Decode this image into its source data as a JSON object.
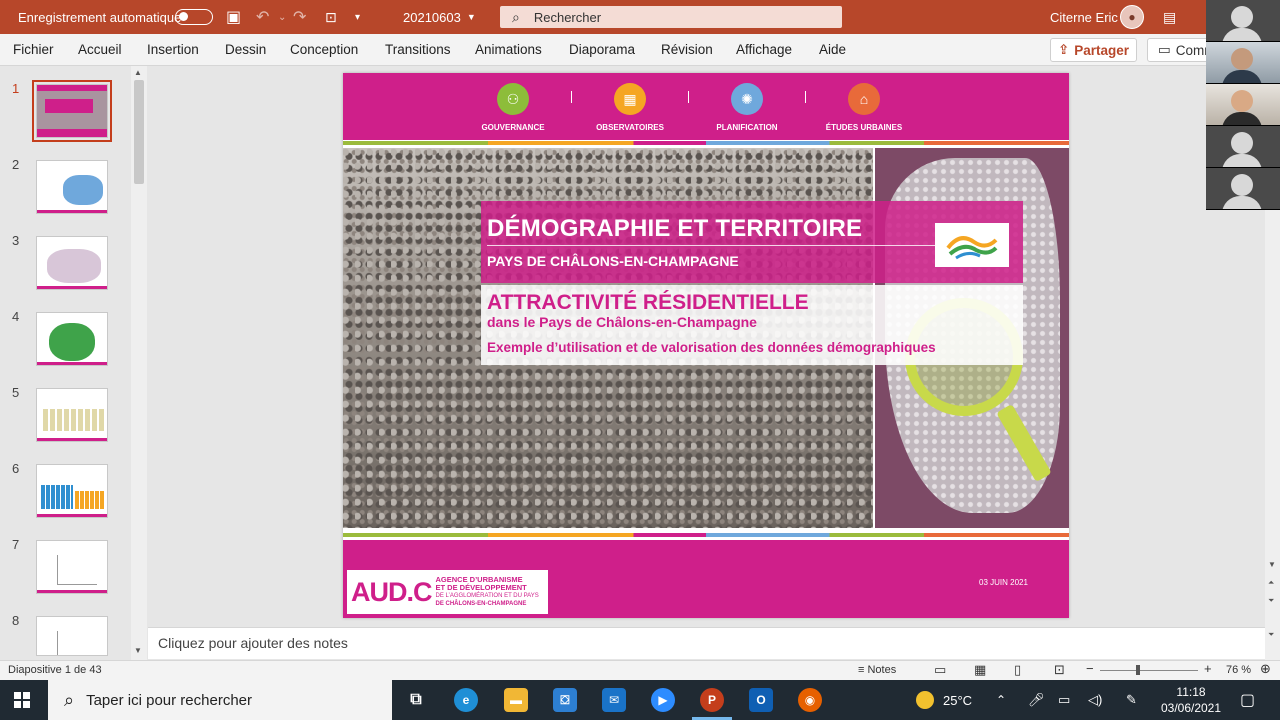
{
  "titlebar": {
    "autosave_label": "Enregistrement automatique",
    "filename": "20210603",
    "search_placeholder": "Rechercher",
    "user_name": "Citerne Eric"
  },
  "menu": {
    "tabs": [
      "Fichier",
      "Accueil",
      "Insertion",
      "Dessin",
      "Conception",
      "Transitions",
      "Animations",
      "Diaporama",
      "Révision",
      "Affichage",
      "Aide"
    ],
    "share_label": "Partager",
    "comments_label": "Comm"
  },
  "thumbnails": {
    "numbers": [
      "1",
      "2",
      "3",
      "4",
      "5",
      "6",
      "7",
      "8"
    ],
    "selected": 1
  },
  "slide": {
    "categories": [
      "GOUVERNANCE",
      "OBSERVATOIRES",
      "PLANIFICATION",
      "ÉTUDES URBAINES"
    ],
    "category_colors": [
      "#8dbd3a",
      "#f5a623",
      "#6fa8dc",
      "#e86a3a"
    ],
    "title": "DÉMOGRAPHIE ET TERRITOIRE",
    "subtitle": "PAYS DE CHÂLONS-EN-CHAMPAGNE",
    "heading": "ATTRACTIVITÉ RÉSIDENTIELLE",
    "heading_sub": "dans le Pays de Châlons-en-Champagne",
    "example_line": "Exemple d’utilisation et de valorisation des données démographiques",
    "aud_mark": "AUD.C",
    "aud_line1": "AGENCE D’URBANISME",
    "aud_line2": "ET DE DÉVELOPPEMENT",
    "aud_line3": "DE L’AGGLOMÉRATION ET DU PAYS",
    "aud_line4": "DE CHÂLONS-EN-CHAMPAGNE",
    "date": "03 JUIN 2021",
    "brand_color": "#cf1f8a"
  },
  "notes_placeholder": "Cliquez pour ajouter des notes",
  "statusbar": {
    "slide_counter": "Diapositive 1 de 43",
    "notes_label": "Notes",
    "zoom_level": "76 %"
  },
  "taskbar": {
    "search_placeholder": "Taper ici pour rechercher",
    "weather": "25°C",
    "time": "11:18",
    "date": "03/06/2021"
  }
}
